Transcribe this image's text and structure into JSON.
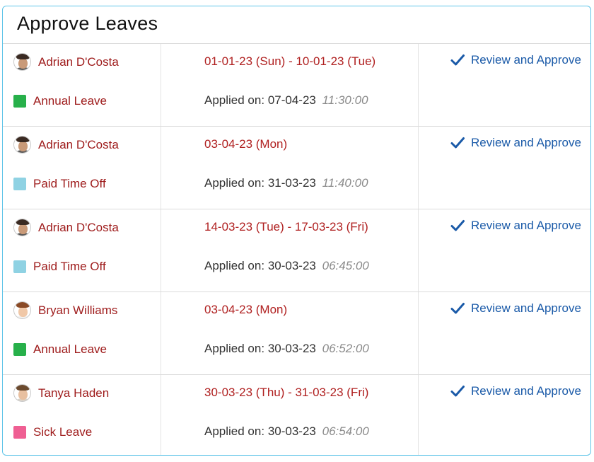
{
  "panel": {
    "title": "Approve Leaves"
  },
  "leave_types": {
    "annual": {
      "color": "#27b04a"
    },
    "pto": {
      "color": "#8fd2e3"
    },
    "sick": {
      "color": "#ef5f93"
    }
  },
  "requests": [
    {
      "employee": "Adrian D'Costa",
      "avatar": {
        "hair": "#3a2a22",
        "skin": "#c99a78",
        "shirt": "#5a5a5a"
      },
      "leave_type": "Annual Leave",
      "type_color": "#27b04a",
      "dates": "01-01-23 (Sun) - 10-01-23 (Tue)",
      "applied_label": "Applied on:",
      "applied_date": "07-04-23",
      "applied_time": "11:30:00",
      "action": "Review and Approve"
    },
    {
      "employee": "Adrian D'Costa",
      "avatar": {
        "hair": "#3a2a22",
        "skin": "#c99a78",
        "shirt": "#5a5a5a"
      },
      "leave_type": "Paid Time Off",
      "type_color": "#8fd2e3",
      "dates": "03-04-23 (Mon)",
      "applied_label": "Applied on:",
      "applied_date": "31-03-23",
      "applied_time": "11:40:00",
      "action": "Review and Approve"
    },
    {
      "employee": "Adrian D'Costa",
      "avatar": {
        "hair": "#3a2a22",
        "skin": "#c99a78",
        "shirt": "#5a5a5a"
      },
      "leave_type": "Paid Time Off",
      "type_color": "#8fd2e3",
      "dates": "14-03-23 (Tue) - 17-03-23 (Fri)",
      "applied_label": "Applied on:",
      "applied_date": "30-03-23",
      "applied_time": "06:45:00",
      "action": "Review and Approve"
    },
    {
      "employee": "Bryan Williams",
      "avatar": {
        "hair": "#8a4a26",
        "skin": "#f0c8a8",
        "shirt": "#f2f2f2"
      },
      "leave_type": "Annual Leave",
      "type_color": "#27b04a",
      "dates": "03-04-23 (Mon)",
      "applied_label": "Applied on:",
      "applied_date": "30-03-23",
      "applied_time": "06:52:00",
      "action": "Review and Approve"
    },
    {
      "employee": "Tanya Haden",
      "avatar": {
        "hair": "#6b4a2e",
        "skin": "#e8c0a0",
        "shirt": "#d9d2c8"
      },
      "leave_type": "Sick Leave",
      "type_color": "#ef5f93",
      "dates": "30-03-23 (Thu) - 31-03-23 (Fri)",
      "applied_label": "Applied on:",
      "applied_date": "30-03-23",
      "applied_time": "06:54:00",
      "action": "Review and Approve"
    }
  ],
  "icons": {
    "approve": "checkmark-icon",
    "avatar": "avatar-icon"
  },
  "colors": {
    "border": "#5ec4e8",
    "name": "#9e1b1b",
    "dates": "#b02020",
    "link": "#1a5aa8",
    "time": "#8a8a8a"
  }
}
